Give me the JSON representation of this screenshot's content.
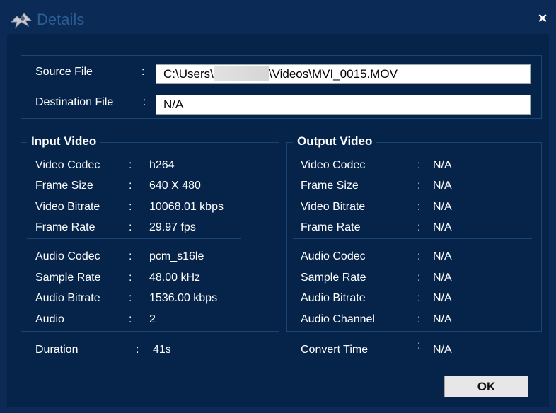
{
  "window": {
    "title": "Details",
    "close_glyph": "×"
  },
  "files": {
    "source_label": "Source File",
    "source_colon": ":",
    "source_value_prefix": "C:\\Users\\",
    "source_value_suffix": "\\Videos\\MVI_0015.MOV",
    "destination_label": "Destination File",
    "destination_colon": ":",
    "destination_value": "N/A"
  },
  "input_video": {
    "title": "Input Video",
    "video_rows": [
      {
        "label": "Video Codec",
        "sep": ":",
        "value": "h264"
      },
      {
        "label": "Frame Size",
        "sep": ":",
        "value": "640 X 480"
      },
      {
        "label": "Video Bitrate",
        "sep": ":",
        "value": "10068.01 kbps"
      },
      {
        "label": "Frame Rate",
        "sep": ":",
        "value": "29.97 fps"
      }
    ],
    "audio_rows": [
      {
        "label": "Audio Codec",
        "sep": ":",
        "value": "pcm_s16le"
      },
      {
        "label": "Sample Rate",
        "sep": ":",
        "value": "48.00 kHz"
      },
      {
        "label": "Audio Bitrate",
        "sep": ":",
        "value": "1536.00 kbps"
      },
      {
        "label": "Audio",
        "sep": ":",
        "value": "2"
      }
    ]
  },
  "output_video": {
    "title": "Output Video",
    "video_rows": [
      {
        "label": "Video Codec",
        "sep": ":",
        "value": "N/A"
      },
      {
        "label": "Frame Size",
        "sep": ":",
        "value": "N/A"
      },
      {
        "label": "Video Bitrate",
        "sep": ":",
        "value": "N/A"
      },
      {
        "label": "Frame Rate",
        "sep": ":",
        "value": "N/A"
      }
    ],
    "audio_rows": [
      {
        "label": "Audio Codec",
        "sep": ":",
        "value": "N/A"
      },
      {
        "label": "Sample Rate",
        "sep": ":",
        "value": "N/A"
      },
      {
        "label": "Audio Bitrate",
        "sep": ":",
        "value": "N/A"
      },
      {
        "label": "Audio Channel",
        "sep": ":",
        "value": "N/A"
      }
    ]
  },
  "footer": {
    "duration_label": "Duration",
    "duration_sep": ":",
    "duration_value": "41s",
    "convert_label": "Convert Time",
    "convert_sep": ":",
    "convert_value": "N/A",
    "ok_label": "OK"
  },
  "colors": {
    "window_bg": "#0b2a55",
    "panel_bg": "#06234a",
    "border": "#1b4474",
    "text": "#ffffff"
  },
  "icons": {
    "app": "app-logo-icon",
    "close": "close-icon"
  }
}
